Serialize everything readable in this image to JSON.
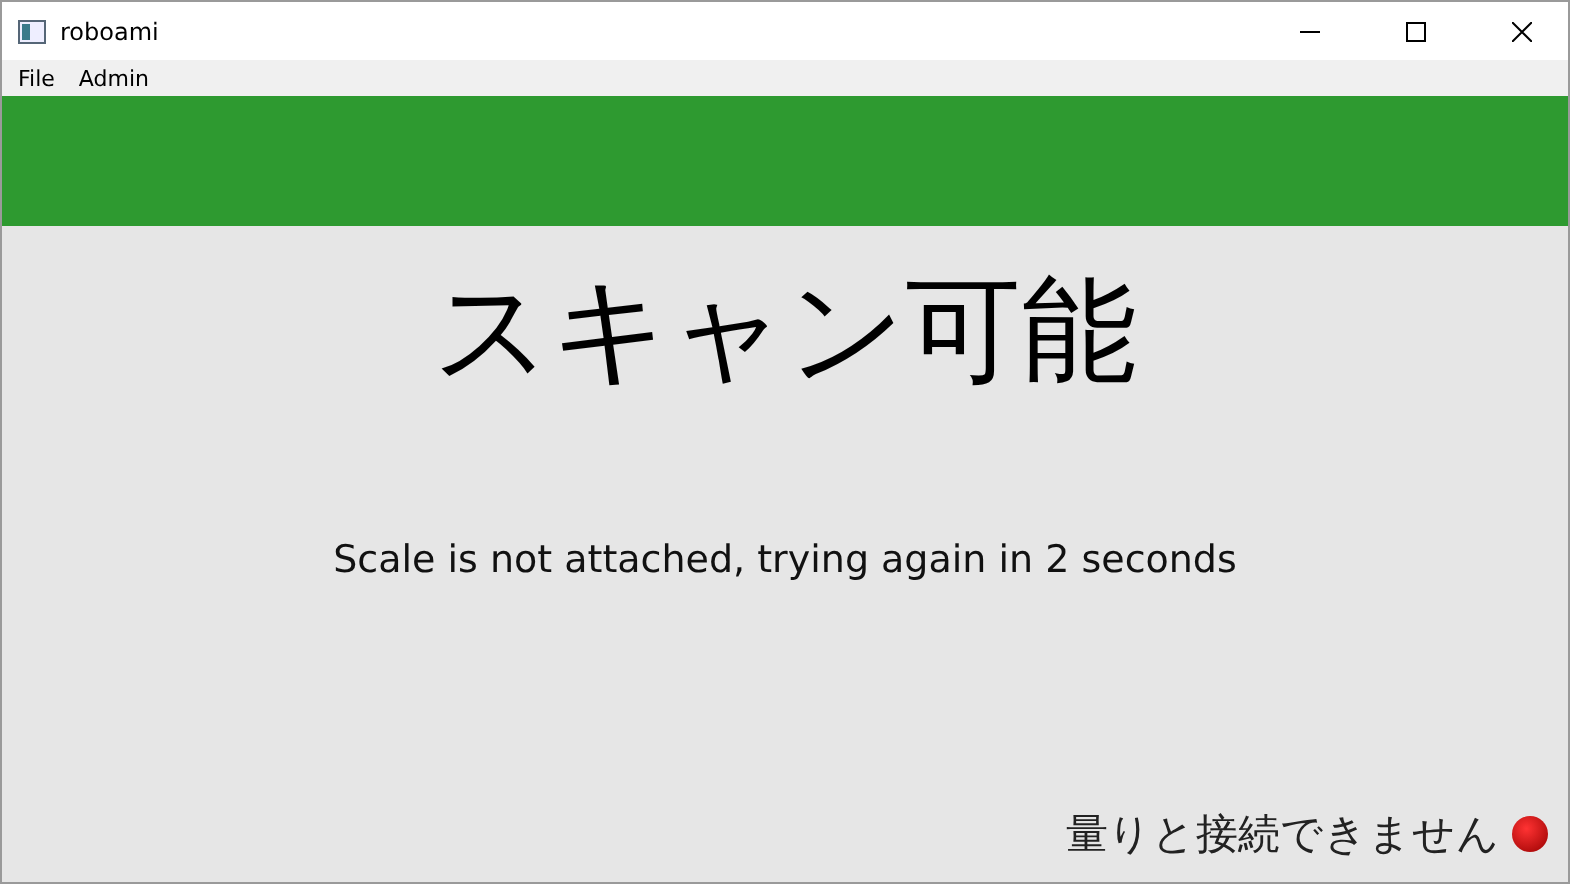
{
  "window": {
    "title": "roboami"
  },
  "menu": [
    "File",
    "Admin"
  ],
  "heading": "スキャン可能",
  "message": "Scale is not attached, trying again in 2 seconds",
  "status": {
    "text": "量りと接続できません",
    "connected": false
  }
}
